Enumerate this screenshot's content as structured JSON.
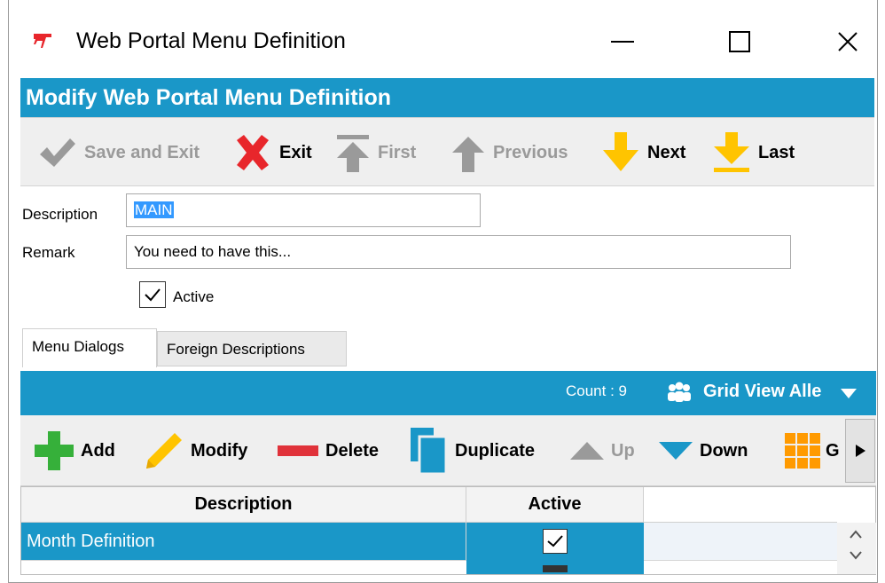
{
  "window": {
    "title": "Web Portal Menu Definition"
  },
  "header": {
    "title": "Modify Web Portal Menu Definition"
  },
  "toolbar": {
    "save_exit": "Save and Exit",
    "exit": "Exit",
    "first": "First",
    "previous": "Previous",
    "next": "Next",
    "last": "Last"
  },
  "form": {
    "description_label": "Description",
    "description_value": "MAIN",
    "remark_label": "Remark",
    "remark_value": "You need to have this...",
    "active_label": "Active",
    "active_checked": true
  },
  "tabs": [
    {
      "label": "Menu Dialogs",
      "active": true
    },
    {
      "label": "Foreign Descriptions",
      "active": false
    }
  ],
  "grid_bar": {
    "count": "Count : 9",
    "view": "Grid View Alle"
  },
  "grid_toolbar": {
    "add": "Add",
    "modify": "Modify",
    "delete": "Delete",
    "duplicate": "Duplicate",
    "up": "Up",
    "down": "Down",
    "grid": "G"
  },
  "table": {
    "columns": [
      "Description",
      "Active"
    ],
    "rows": [
      {
        "description": "Month Definition",
        "active": true
      }
    ]
  },
  "colors": {
    "accent": "#1a97c8",
    "arrow_yellow": "#ffc400",
    "exit_red": "#e8262b",
    "add_green": "#36b03a",
    "delete_red": "#e0323a",
    "grid_orange": "#ff9a00"
  },
  "icons": [
    "app-logo-icon",
    "minimize-icon",
    "maximize-icon",
    "close-icon",
    "checkmark-icon",
    "x-icon",
    "first-arrow-icon",
    "up-arrow-icon",
    "down-arrow-icon",
    "last-arrow-icon",
    "users-icon",
    "dropdown-icon",
    "plus-icon",
    "pencil-icon",
    "minus-icon",
    "duplicate-icon",
    "triangle-up-icon",
    "triangle-down-icon",
    "grid-icon",
    "scroll-right-icon"
  ]
}
